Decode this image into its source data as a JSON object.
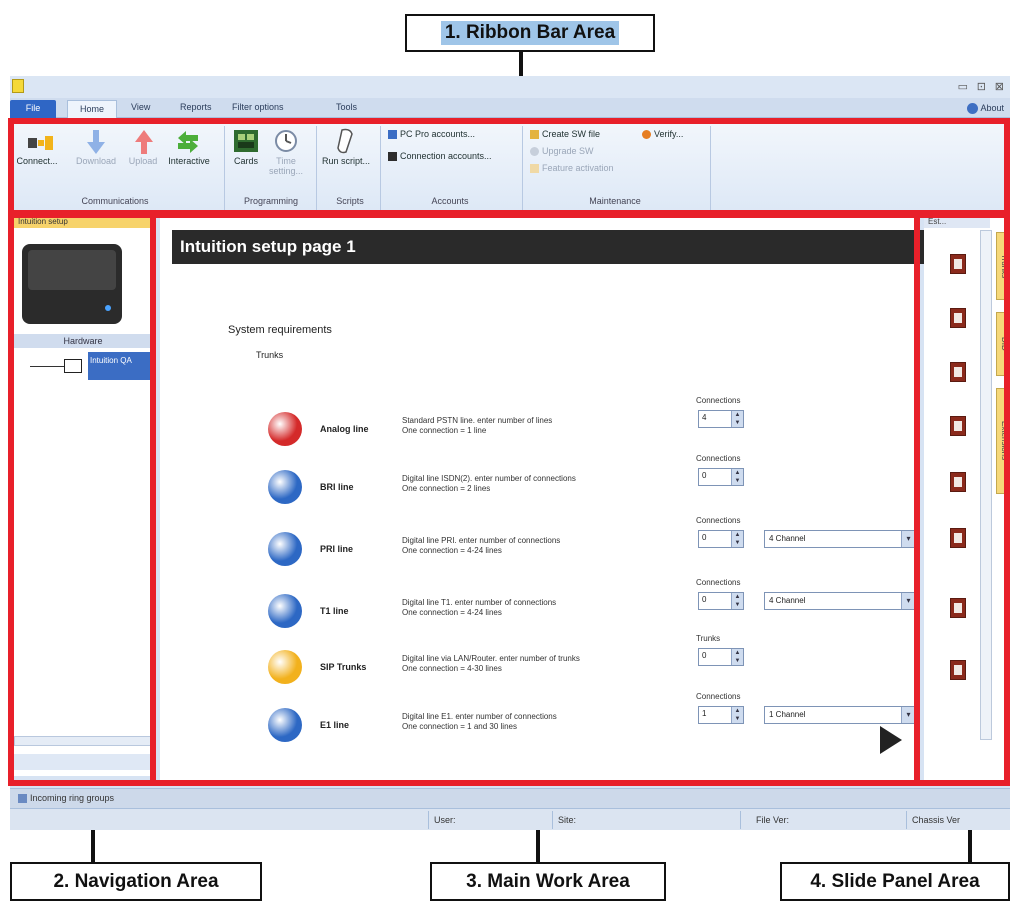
{
  "callouts": {
    "ribbon": "1. Ribbon Bar Area",
    "navigation": "2. Navigation Area",
    "main_work": "3. Main Work Area",
    "slide_panel": "4. Slide Panel Area"
  },
  "window": {
    "controls": [
      "▭",
      "⊡",
      "⊠"
    ]
  },
  "tabs": [
    "File",
    "Home",
    "View",
    "Reports",
    "Filter options",
    "Tools"
  ],
  "about_label": "About",
  "ribbon": {
    "communications": {
      "label": "Communications",
      "buttons": [
        "Connect...",
        "Download",
        "Upload",
        "Interactive"
      ]
    },
    "programming": {
      "label": "Programming",
      "buttons": [
        "Cards",
        "Time setting..."
      ]
    },
    "scripts": {
      "label": "Scripts",
      "buttons": [
        "Run script..."
      ]
    },
    "accounts": {
      "label": "Accounts",
      "items": [
        "PC Pro accounts...",
        "Connection accounts..."
      ]
    },
    "maintenance": {
      "label": "Maintenance",
      "items": [
        "Create SW file",
        "Upgrade SW",
        "Feature activation",
        "Verify..."
      ]
    }
  },
  "navigation": {
    "header": "Intuition setup",
    "hardware_label": "Hardware",
    "tree_item": "Intuition QA"
  },
  "main": {
    "page_title": "Intuition setup page 1",
    "section_title": "System requirements",
    "sub_title": "Trunks",
    "rows": [
      {
        "name": "Analog line",
        "desc1": "Standard PSTN line. enter number of lines",
        "desc2": "One connection = 1 line",
        "field_label": "Connections",
        "value": "4",
        "select": "",
        "color": "#d42a2a"
      },
      {
        "name": "BRI line",
        "desc1": "Digital line ISDN(2). enter number of connections",
        "desc2": "One connection = 2 lines",
        "field_label": "Connections",
        "value": "0",
        "select": "",
        "color": "#2d68c4"
      },
      {
        "name": "PRI line",
        "desc1": "Digital line PRI. enter number of connections",
        "desc2": "One connection = 4-24 lines",
        "field_label": "Connections",
        "value": "0",
        "select": "4 Channel",
        "color": "#2d68c4"
      },
      {
        "name": "T1 line",
        "desc1": "Digital line T1. enter number of connections",
        "desc2": "One connection = 4-24 lines",
        "field_label": "Connections",
        "value": "0",
        "select": "4 Channel",
        "color": "#2d68c4"
      },
      {
        "name": "SIP Trunks",
        "desc1": "Digital line via LAN/Router. enter number of trunks",
        "desc2": "One connection = 4-30 lines",
        "field_label": "Trunks",
        "value": "0",
        "select": "",
        "color": "#f2b11d"
      },
      {
        "name": "E1 line",
        "desc1": "Digital line E1. enter number of connections",
        "desc2": "One connection = 1 and 30 lines",
        "field_label": "Connections",
        "value": "1",
        "select": "1 Channel",
        "color": "#2d68c4"
      }
    ]
  },
  "slide_panel": {
    "header": "Est...",
    "tabs": [
      "Trunks",
      "DID",
      "Extensions"
    ]
  },
  "taskbar": {
    "item": "Incoming ring groups"
  },
  "status": {
    "user": "User:",
    "site": "Site:",
    "file_ver": "File Ver:",
    "chassis": "Chassis Ver"
  }
}
